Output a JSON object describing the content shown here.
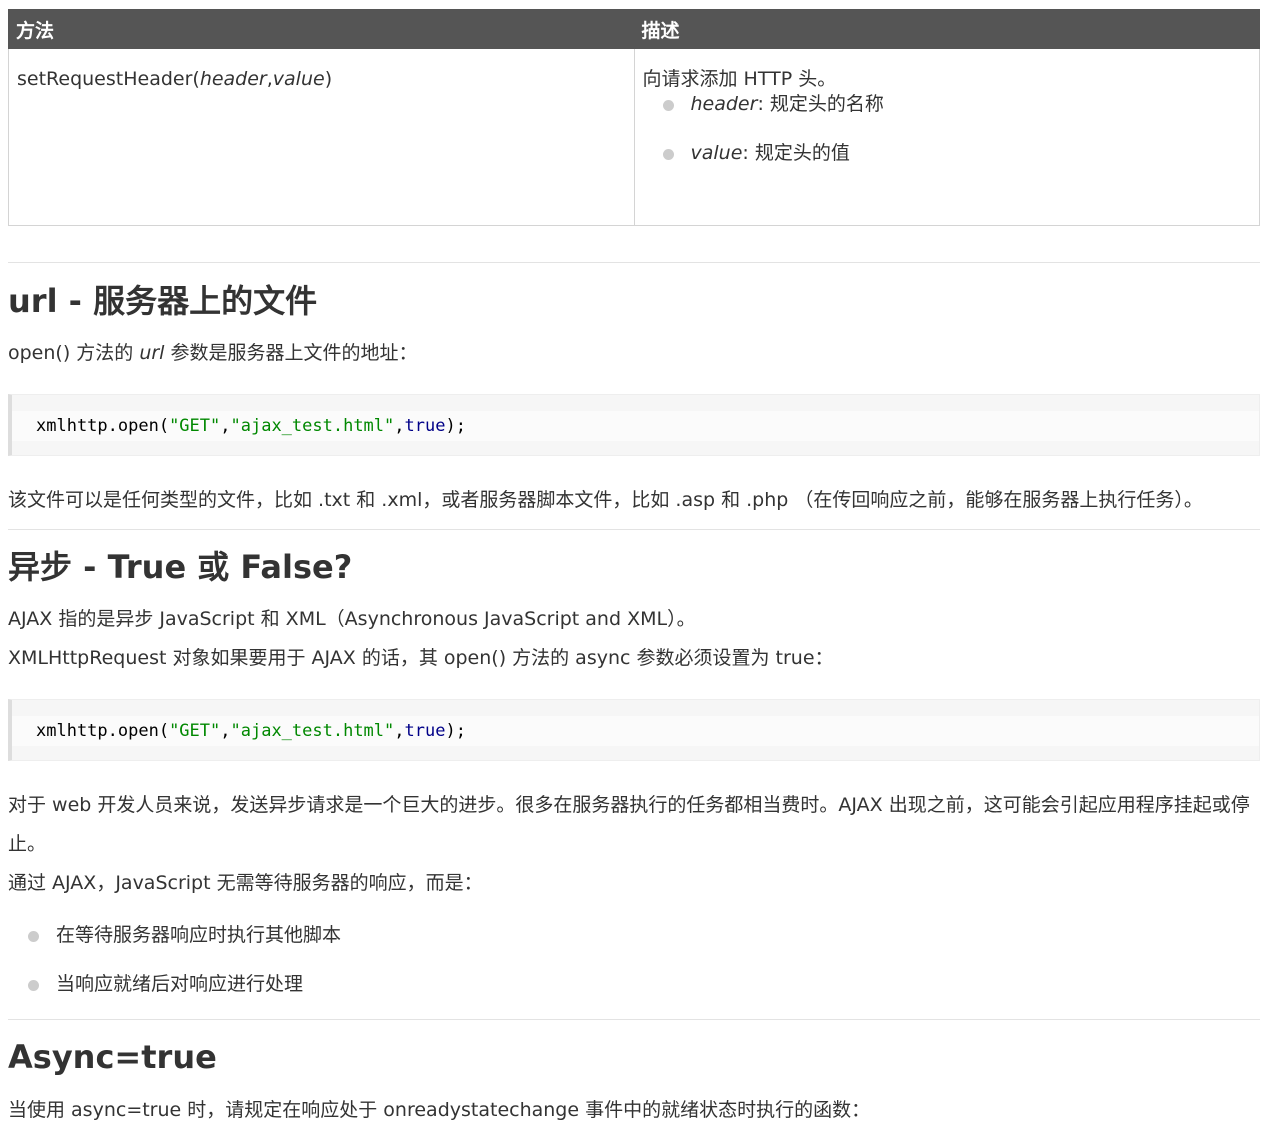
{
  "table": {
    "headers": [
      "方法",
      "描述"
    ],
    "row": {
      "method_prefix": "setRequestHeader(",
      "method_arg1": "header",
      "method_sep": ",",
      "method_arg2": "value",
      "method_suffix": ")",
      "desc": "向请求添加 HTTP 头。",
      "bullets": [
        {
          "term": "header",
          "text": ": 规定头的名称"
        },
        {
          "term": "value",
          "text": ": 规定头的值"
        }
      ]
    }
  },
  "sec_url": {
    "heading": "url - 服务器上的文件",
    "intro_a": "open() 方法的 ",
    "intro_em": "url",
    "intro_b": " 参数是服务器上文件的地址：",
    "code": {
      "fn": "xmlhttp.open(",
      "s1": "\"GET\"",
      "comma1": ",",
      "s2": "\"ajax_test.html\"",
      "comma2": ",",
      "kw": "true",
      "end": ");"
    },
    "after": "该文件可以是任何类型的文件，比如 .txt 和 .xml，或者服务器脚本文件，比如 .asp 和 .php （在传回响应之前，能够在服务器上执行任务）。"
  },
  "sec_async": {
    "heading": "异步 - True 或 False?",
    "p1": "AJAX 指的是异步 JavaScript 和 XML（Asynchronous JavaScript and XML）。",
    "p2": "XMLHttpRequest 对象如果要用于 AJAX 的话，其 open() 方法的 async 参数必须设置为 true：",
    "code": {
      "fn": "xmlhttp.open(",
      "s1": "\"GET\"",
      "comma1": ",",
      "s2": "\"ajax_test.html\"",
      "comma2": ",",
      "kw": "true",
      "end": ");"
    },
    "p3": "对于 web 开发人员来说，发送异步请求是一个巨大的进步。很多在服务器执行的任务都相当费时。AJAX 出现之前，这可能会引起应用程序挂起或停止。",
    "p4": "通过 AJAX，JavaScript 无需等待服务器的响应，而是：",
    "bullets": [
      "在等待服务器响应时执行其他脚本",
      "当响应就绪后对响应进行处理"
    ]
  },
  "sec_true": {
    "heading": "Async=true",
    "p1": "当使用 async=true 时，请规定在响应处于 onreadystatechange 事件中的就绪状态时执行的函数："
  }
}
